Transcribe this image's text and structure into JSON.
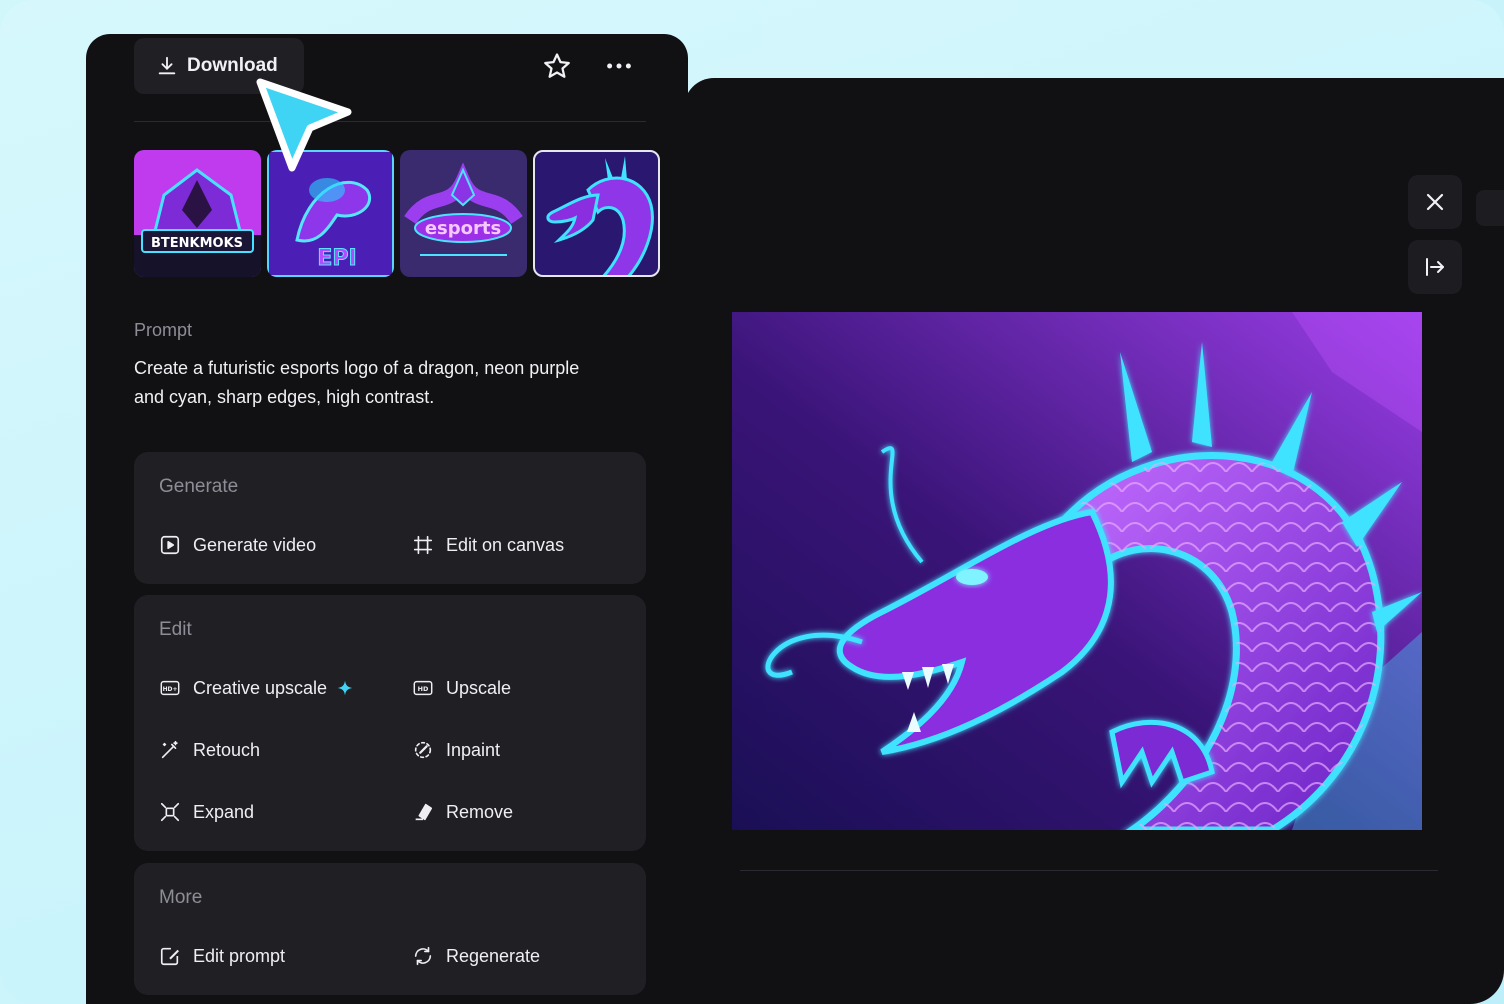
{
  "toolbar": {
    "download_label": "Download"
  },
  "thumbnails": [
    {
      "name": "thumb-btenkmoks",
      "caption": "BTENKMOKS"
    },
    {
      "name": "thumb-epic",
      "caption": "EPI"
    },
    {
      "name": "thumb-esports",
      "caption": "esports"
    },
    {
      "name": "thumb-dragon-neon",
      "caption": ""
    }
  ],
  "prompt": {
    "label": "Prompt",
    "text": "Create a futuristic esports logo of a dragon, neon purple and cyan, sharp edges, high contrast."
  },
  "sections": {
    "generate": {
      "title": "Generate",
      "generate_video": "Generate video",
      "edit_on_canvas": "Edit on canvas"
    },
    "edit": {
      "title": "Edit",
      "creative_upscale": "Creative upscale",
      "upscale": "Upscale",
      "retouch": "Retouch",
      "inpaint": "Inpaint",
      "expand": "Expand",
      "remove": "Remove"
    },
    "more": {
      "title": "More",
      "edit_prompt": "Edit prompt",
      "regenerate": "Regenerate"
    }
  },
  "icons": {
    "download": "download-icon",
    "star": "star-icon",
    "more": "more-horizontal-icon",
    "close": "close-icon",
    "collapse": "collapse-panel-icon"
  },
  "colors": {
    "panel_bg": "#111114",
    "card_bg": "#1f1f24",
    "accent_cyan": "#3fd4f4",
    "neon_purple": "#a43cf0"
  }
}
